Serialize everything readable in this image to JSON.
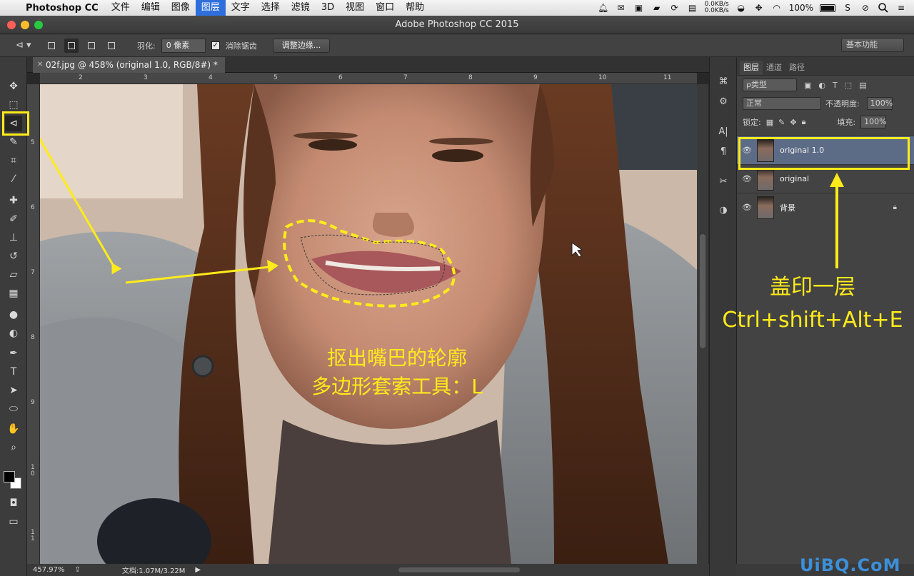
{
  "menubar": {
    "app_name": "Photoshop CC",
    "items": [
      "文件",
      "编辑",
      "图像",
      "图层",
      "文字",
      "选择",
      "滤镜",
      "3D",
      "视图",
      "窗口",
      "帮助"
    ],
    "active_item": "图层",
    "net_up": "0.0KB/s",
    "net_down": "0.0KB/s",
    "battery": "100%"
  },
  "window": {
    "title": "Adobe Photoshop CC 2015"
  },
  "options": {
    "feather_label": "羽化:",
    "feather_value": "0 像素",
    "antialias_label": "消除锯齿",
    "refine_edge_label": "调整边缘...",
    "workspace": "基本功能"
  },
  "document": {
    "tab_title": "02f.jpg @ 458% (original 1.0, RGB/8#) *",
    "zoom": "457.97%",
    "doc_size": "文档:1.07M/3.22M",
    "ruler_top": [
      "2",
      "3",
      "4",
      "5",
      "6",
      "7",
      "8",
      "9",
      "10",
      "11"
    ],
    "ruler_left": [
      "5",
      "6",
      "7",
      "8",
      "9",
      "1 0",
      "1 1"
    ]
  },
  "layers_panel": {
    "tabs": [
      "图层",
      "通道",
      "路径"
    ],
    "active_tab": "图层",
    "filter_kind": "ρ类型",
    "blend_mode": "正常",
    "opacity_label": "不透明度:",
    "opacity_value": "100%",
    "lock_label": "锁定:",
    "fill_label": "填充:",
    "fill_value": "100%",
    "layers": [
      {
        "name": "original 1.0",
        "selected": true,
        "locked": false
      },
      {
        "name": "original",
        "selected": false,
        "locked": false
      },
      {
        "name": "背景",
        "selected": false,
        "locked": true
      }
    ]
  },
  "annotations": {
    "stamp_title": "盖印一层",
    "stamp_shortcut": "Ctrl+shift+Alt+E",
    "lasso_line1": "抠出嘴巴的轮廓",
    "lasso_line2": "多边形套索工具：L"
  },
  "watermark": "UiBQ.CoM",
  "colors": {
    "annotation": "#ffeb1a",
    "selected_layer": "#5c6b86",
    "menu_active": "#2f6fdc"
  }
}
